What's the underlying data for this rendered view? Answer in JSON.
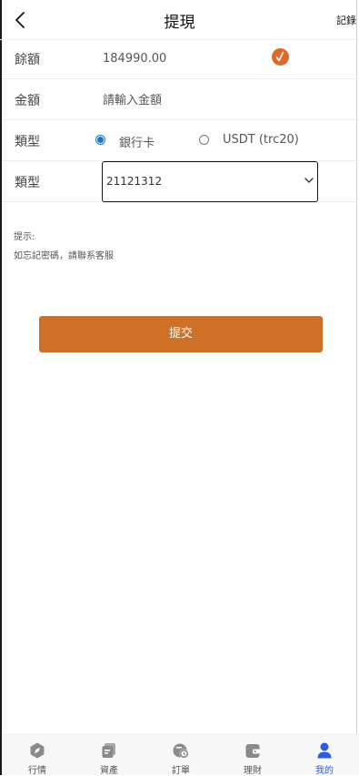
{
  "header": {
    "title": "提現",
    "records_label": "記錄",
    "back_icon": "chevron-left-icon"
  },
  "form": {
    "balance": {
      "label": "餘額",
      "value": "184990.00",
      "confirm_icon": "checkmark-circle-icon",
      "confirm_color": "#e0692a"
    },
    "amount": {
      "label": "金額",
      "placeholder": "請輸入金額",
      "value": ""
    },
    "type": {
      "label": "類型",
      "options": [
        {
          "label": "銀行卡",
          "selected": true
        },
        {
          "label": "USDT (trc20)",
          "selected": false
        }
      ],
      "radio_color": "#1a73c9"
    },
    "account": {
      "label": "類型",
      "selected_value": "21121312",
      "chevron_icon": "chevron-down-icon"
    }
  },
  "hint": {
    "title": "提示:",
    "text": "如忘記密碼，請聯系客服"
  },
  "submit": {
    "label": "提交",
    "color": "#cf7028"
  },
  "bottom_nav": {
    "active_color": "#2d5be3",
    "items": [
      {
        "label": "行情",
        "icon": "compass-icon",
        "active": false
      },
      {
        "label": "資產",
        "icon": "wallet-cards-icon",
        "active": false
      },
      {
        "label": "訂單",
        "icon": "orders-icon",
        "active": false
      },
      {
        "label": "理財",
        "icon": "purse-icon",
        "active": false
      },
      {
        "label": "我的",
        "icon": "user-icon",
        "active": true
      }
    ]
  }
}
